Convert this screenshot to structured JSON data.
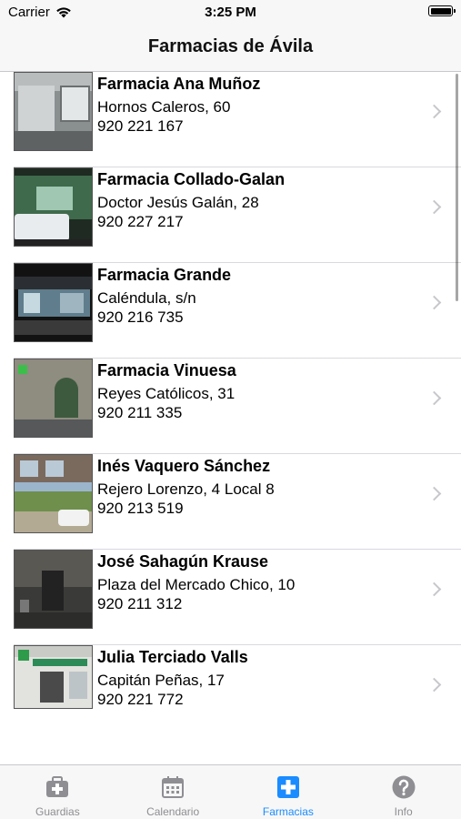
{
  "status_bar": {
    "carrier": "Carrier",
    "time": "3:25 PM"
  },
  "nav": {
    "title": "Farmacias de Ávila"
  },
  "pharmacies": [
    {
      "name": "Farmacia Ana Muñoz",
      "address": "Hornos Caleros, 60",
      "phone": "920 221 167"
    },
    {
      "name": "Farmacia Collado-Galan",
      "address": "Doctor Jesús Galán, 28",
      "phone": "920 227 217"
    },
    {
      "name": "Farmacia Grande",
      "address": "Caléndula, s/n",
      "phone": "920 216 735"
    },
    {
      "name": "Farmacia Vinuesa",
      "address": "Reyes Católicos, 31",
      "phone": "920 211 335"
    },
    {
      "name": "Inés Vaquero Sánchez",
      "address": "Rejero Lorenzo, 4 Local 8",
      "phone": "920 213 519"
    },
    {
      "name": "José Sahagún Krause",
      "address": "Plaza del Mercado Chico, 10",
      "phone": "920 211 312"
    },
    {
      "name": "Julia Terciado Valls",
      "address": "Capitán Peñas, 17",
      "phone": "920 221 772"
    }
  ],
  "tabs": [
    {
      "label": "Guardias",
      "icon": "first-aid-kit-icon",
      "active": false
    },
    {
      "label": "Calendario",
      "icon": "calendar-icon",
      "active": false
    },
    {
      "label": "Farmacias",
      "icon": "pharmacy-cross-icon",
      "active": true
    },
    {
      "label": "Info",
      "icon": "help-icon",
      "active": false
    }
  ],
  "colors": {
    "accent": "#1a8cff",
    "tab_inactive": "#8e8e93",
    "chevron": "#c7c7cc"
  }
}
